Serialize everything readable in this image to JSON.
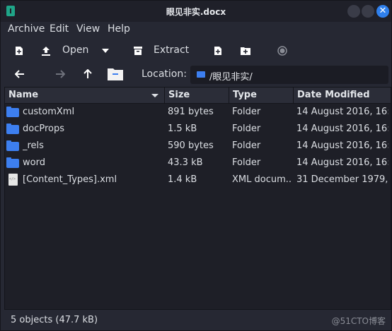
{
  "window": {
    "title": "眼见非实.docx"
  },
  "menu": {
    "items": [
      {
        "label": "Archive"
      },
      {
        "label": "Edit"
      },
      {
        "label": "View"
      },
      {
        "label": "Help"
      }
    ]
  },
  "toolbar": {
    "open_label": "Open",
    "extract_label": "Extract"
  },
  "location": {
    "label": "Location:",
    "path": "/眼见非实/"
  },
  "table": {
    "columns": [
      "Name",
      "Size",
      "Type",
      "Date Modified"
    ],
    "rows": [
      {
        "icon": "folder-icon",
        "name": "customXml",
        "size": "891 bytes",
        "type": "Folder",
        "date": "14 August 2016, 16:..."
      },
      {
        "icon": "folder-icon",
        "name": "docProps",
        "size": "1.5 kB",
        "type": "Folder",
        "date": "14 August 2016, 16:..."
      },
      {
        "icon": "folder-icon",
        "name": "_rels",
        "size": "590 bytes",
        "type": "Folder",
        "date": "14 August 2016, 16:..."
      },
      {
        "icon": "folder-icon",
        "name": "word",
        "size": "43.3 kB",
        "type": "Folder",
        "date": "14 August 2016, 16:..."
      },
      {
        "icon": "xml-file-icon",
        "name": "[Content_Types].xml",
        "size": "1.4 kB",
        "type": "XML docum...",
        "date": "31 December 1979,..."
      }
    ]
  },
  "status": {
    "text": "5 objects (47.7 kB)",
    "watermark": "@51CTO博客"
  },
  "colors": {
    "accent": "#2f80ed",
    "folder": "#3d7ff0"
  }
}
